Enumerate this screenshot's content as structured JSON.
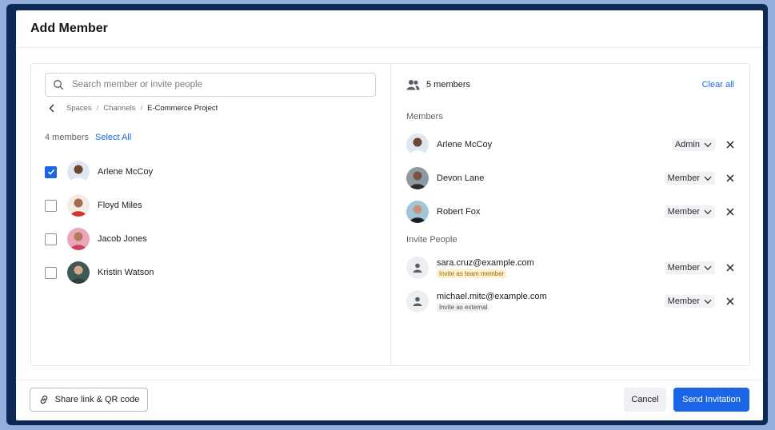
{
  "dialog": {
    "title": "Add Member"
  },
  "search": {
    "placeholder": "Search member or invite people",
    "icon": "search-icon"
  },
  "breadcrumb": {
    "items": [
      "Spaces",
      "Channels",
      "E-Commerce Project"
    ]
  },
  "left_list": {
    "count_label": "4 members",
    "select_all_label": "Select All",
    "members": [
      {
        "name": "Arlene McCoy",
        "checked": true,
        "avatar_bg": "#dfe7f2",
        "skin": "#6b4630",
        "shirt": "#ffffff"
      },
      {
        "name": "Floyd Miles",
        "checked": false,
        "avatar_bg": "#f3ece6",
        "skin": "#a46b4b",
        "shirt": "#d7322b"
      },
      {
        "name": "Jacob Jones",
        "checked": false,
        "avatar_bg": "#e9a7b9",
        "skin": "#b57b5c",
        "shirt": "#c94560"
      },
      {
        "name": "Kristin Watson",
        "checked": false,
        "avatar_bg": "#3e5a57",
        "skin": "#d7a78a",
        "shirt": "#2f3f3c"
      }
    ]
  },
  "right_panel": {
    "member_count": "5 members",
    "clear_all_label": "Clear all",
    "members_section_label": "Members",
    "invite_section_label": "Invite People",
    "members": [
      {
        "name": "Arlene McCoy",
        "role": "Admin",
        "avatar_bg": "#dfe7f2",
        "skin": "#6b4630",
        "shirt": "#ffffff"
      },
      {
        "name": "Devon Lane",
        "role": "Member",
        "avatar_bg": "#8e9aa3",
        "skin": "#7a5441",
        "shirt": "#2a2c30"
      },
      {
        "name": "Robert Fox",
        "role": "Member",
        "avatar_bg": "#9fc7d9",
        "skin": "#c79576",
        "shirt": "#1f1f22"
      }
    ],
    "invites": [
      {
        "email": "sara.cruz@example.com",
        "tag": "Invite as team member",
        "tag_type": "team",
        "role": "Member"
      },
      {
        "email": "michael.mitc@example.com",
        "tag": "Invite as external",
        "tag_type": "external",
        "role": "Member"
      }
    ]
  },
  "footer": {
    "share_label": "Share link & QR code",
    "cancel_label": "Cancel",
    "send_label": "Send Invitation"
  },
  "colors": {
    "accent": "#1a66e6",
    "frame": "#0c2a55",
    "background": "#93aedc"
  }
}
